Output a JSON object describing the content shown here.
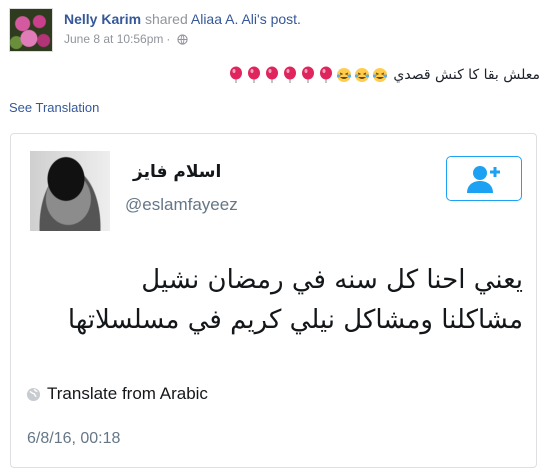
{
  "post": {
    "author": "Nelly Karim",
    "action": "shared",
    "shared_author": "Aliaa A. Ali's",
    "shared_suffix": "post.",
    "timestamp": "June 8 at 10:56pm",
    "separator": "·",
    "privacy_icon": "globe-icon",
    "text": "معلش بقا كا كنش قصدي",
    "emojis": [
      "laughing-tears",
      "laughing-tears",
      "laughing-tears",
      "balloon",
      "balloon",
      "balloon",
      "balloon",
      "balloon",
      "balloon"
    ],
    "see_translation": "See Translation"
  },
  "tweet": {
    "name": "اسلام فايز",
    "handle": "@eslamfayeez",
    "follow_icon": "add-user-icon",
    "body_line1": "يعني احنا كل سنه في رمضان نشيل",
    "body_line2": "مشاكلنا ومشاكل نيلي كريم في مسلسلاتها",
    "translate_label": "Translate from Arabic",
    "date": "6/8/16, 00:18"
  },
  "colors": {
    "link": "#365899",
    "twitter_blue": "#1da1f2",
    "muted": "#90949c",
    "balloon": "#e0245e",
    "emoji_yellow": "#ffcc4d"
  }
}
